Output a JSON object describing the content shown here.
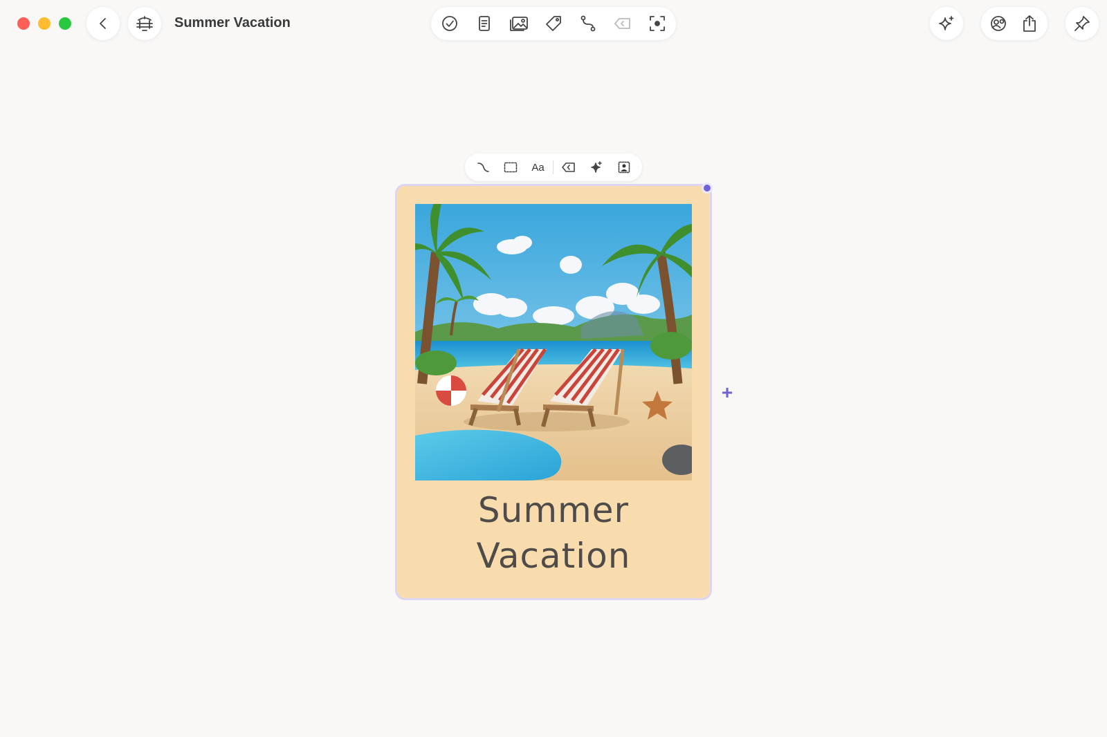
{
  "window": {
    "title": "Summer Vacation"
  },
  "toolbar": {
    "left": [
      {
        "name": "back",
        "icon": "chevron-left-icon"
      },
      {
        "name": "board",
        "icon": "board-icon"
      }
    ],
    "center_tools": [
      {
        "name": "checklist",
        "icon": "check-circle-icon"
      },
      {
        "name": "note",
        "icon": "note-icon"
      },
      {
        "name": "image",
        "icon": "image-icon"
      },
      {
        "name": "tag",
        "icon": "tag-icon"
      },
      {
        "name": "connector",
        "icon": "connector-icon"
      },
      {
        "name": "label",
        "icon": "label-tag-icon"
      },
      {
        "name": "focus",
        "icon": "focus-icon"
      }
    ],
    "right": [
      {
        "name": "ai",
        "icon": "sparkle-icon"
      },
      {
        "name": "collaborators",
        "icon": "people-icon"
      },
      {
        "name": "share",
        "icon": "share-icon"
      },
      {
        "name": "pin",
        "icon": "pin-icon"
      }
    ]
  },
  "card_toolbar": {
    "items": [
      {
        "name": "connector",
        "icon": "curve-icon"
      },
      {
        "name": "frame",
        "icon": "dashed-rect-icon"
      },
      {
        "name": "text",
        "label": "Aa"
      },
      {
        "name": "label",
        "icon": "label-tag-icon"
      },
      {
        "name": "ai",
        "icon": "sparkle-icon"
      },
      {
        "name": "remove-background",
        "icon": "person-cutout-icon"
      }
    ]
  },
  "card": {
    "title": "Summer Vacation",
    "title_line1": "Summer",
    "title_line2": "Vacation",
    "image_description_icon": "beach-scene-image",
    "background_color": "#f8dcae",
    "selection_color": "#6e62d6"
  },
  "card_add_button": {
    "symbol": "+"
  }
}
